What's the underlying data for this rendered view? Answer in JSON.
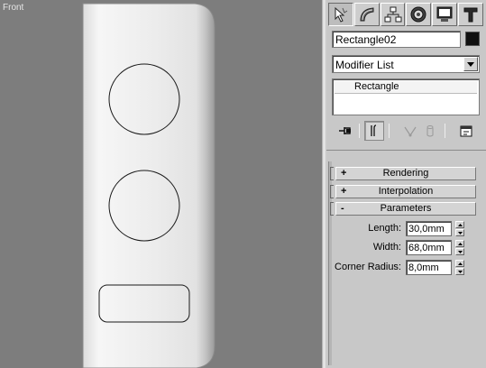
{
  "viewport": {
    "label": "Front"
  },
  "command_panel": {
    "tabs": [
      {
        "name": "create",
        "icon": "create-arrow-icon",
        "active": true
      },
      {
        "name": "modify",
        "icon": "modify-bend-icon",
        "active": false
      },
      {
        "name": "hierarchy",
        "icon": "hierarchy-icon",
        "active": false
      },
      {
        "name": "motion",
        "icon": "motion-icon",
        "active": false
      },
      {
        "name": "display",
        "icon": "display-monitor-icon",
        "active": false
      },
      {
        "name": "utilities",
        "icon": "utilities-hammer-icon",
        "active": false
      }
    ],
    "object_name": "Rectangle02",
    "object_color": "#101010",
    "modifier_list": "Modifier List",
    "stack": {
      "items": [
        "Rectangle"
      ]
    },
    "rollouts": {
      "rendering": {
        "sign": "+",
        "title": "Rendering"
      },
      "interpolation": {
        "sign": "+",
        "title": "Interpolation"
      },
      "parameters": {
        "sign": "-",
        "title": "Parameters"
      }
    },
    "parameters": {
      "length": {
        "label": "Length:",
        "value": "30,0mm"
      },
      "width": {
        "label": "Width:",
        "value": "68,0mm"
      },
      "corner_radius": {
        "label": "Corner Radius:",
        "value": "8,0mm"
      }
    }
  }
}
